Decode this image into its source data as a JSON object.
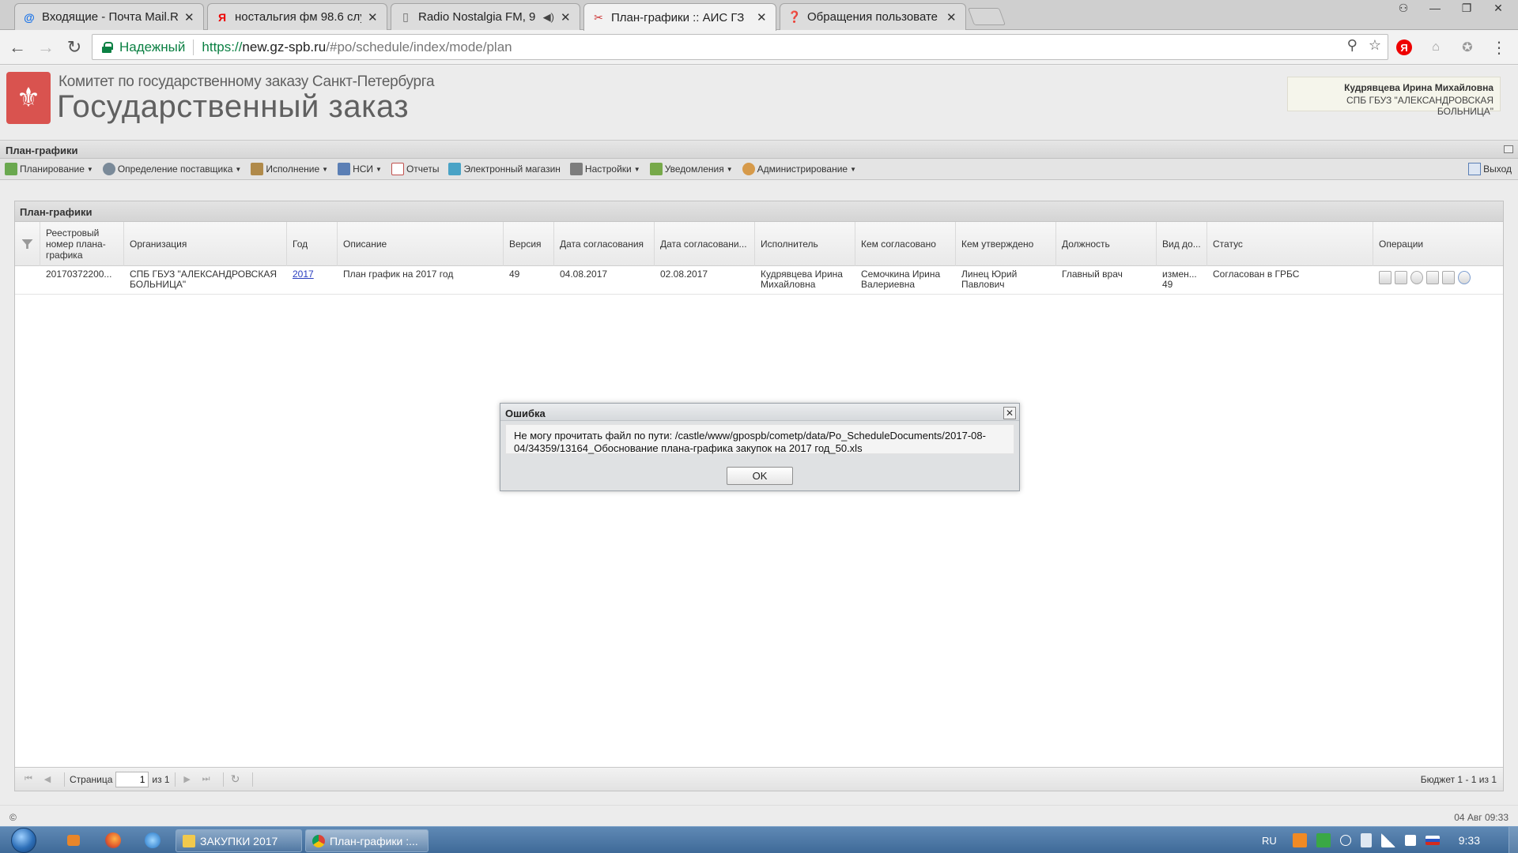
{
  "browser": {
    "tabs": [
      {
        "title": "Входящие - Почта Mail.R",
        "icon": "mail-icon",
        "active": false
      },
      {
        "title": "ностальгия фм 98.6 слу",
        "icon": "yandex-icon",
        "active": false
      },
      {
        "title": "Radio Nostalgia FM, 9",
        "icon": "page-icon",
        "active": false,
        "audio": true
      },
      {
        "title": "План-графики :: АИС ГЗ",
        "icon": "tools-icon",
        "active": true
      },
      {
        "title": "Обращения пользовате",
        "icon": "help-icon",
        "active": false
      }
    ],
    "secure_label": "Надежный",
    "url_scheme": "https://",
    "url_host": "new.gz-spb.ru",
    "url_path": "/#po/schedule/index/mode/plan"
  },
  "header": {
    "org_sub": "Комитет по государственному заказу Санкт-Петербурга",
    "org_main": "Государственный заказ",
    "user_name": "Кудрявцева Ирина Михайловна",
    "user_org": "СПБ ГБУЗ \"АЛЕКСАНДРОВСКАЯ БОЛЬНИЦА\""
  },
  "module_title": "План-графики",
  "menu": [
    {
      "label": "Планирование",
      "caret": true,
      "color": "#6aa84f"
    },
    {
      "label": "Определение поставщика",
      "caret": true,
      "color": "#7a8a99"
    },
    {
      "label": "Исполнение",
      "caret": true,
      "color": "#b08a4a"
    },
    {
      "label": "НСИ",
      "caret": true,
      "color": "#5b7fb5"
    },
    {
      "label": "Отчеты",
      "caret": false,
      "color": "#c0504d"
    },
    {
      "label": "Электронный магазин",
      "caret": false,
      "color": "#4aa3c6"
    },
    {
      "label": "Настройки",
      "caret": true,
      "color": "#7d7d7d"
    },
    {
      "label": "Уведомления",
      "caret": true,
      "color": "#77a94a"
    },
    {
      "label": "Администрирование",
      "caret": true,
      "color": "#d69a4a"
    }
  ],
  "logout_label": "Выход",
  "panel_title": "План-графики",
  "grid": {
    "columns": [
      "Реестровый номер плана-графика",
      "Организация",
      "Год",
      "Описание",
      "Версия",
      "Дата согласования",
      "Дата согласовани...",
      "Исполнитель",
      "Кем согласовано",
      "Кем утверждено",
      "Должность",
      "Вид до...",
      "Статус",
      "Операции"
    ],
    "rows": [
      {
        "reg_number": "20170372200...",
        "org": "СПБ ГБУЗ \"АЛЕКСАНДРОВСКАЯ БОЛЬНИЦА\"",
        "year": "2017",
        "description": "План график на 2017 год",
        "version": "49",
        "approve_date": "04.08.2017",
        "approve_date2": "02.08.2017",
        "executor": "Кудрявцева Ирина Михайловна",
        "agreed_by": "Семочкина Ирина Валериевна",
        "approved_by": "Линец Юрий Павлович",
        "position": "Главный врач",
        "doc_type": "измен... 49",
        "status": "Согласован в ГРБС"
      }
    ]
  },
  "pager": {
    "page_label": "Страница",
    "page_value": "1",
    "of_label": "из 1",
    "info": "Бюджет 1 - 1 из 1"
  },
  "footer": {
    "copyright": "©",
    "datetime": "04 Авг 09:33"
  },
  "dialog": {
    "title": "Ошибка",
    "message": "Не могу прочитать файл по пути: /castle/www/gpospb/cometp/data/Po_ScheduleDocuments/2017-08-04/34359/13164_Обоснование плана-графика закупок на 2017 год_50.xls",
    "ok_label": "OK"
  },
  "taskbar": {
    "tasks": [
      {
        "label": "ЗАКУПКИ 2017",
        "icon": "folder-icon"
      },
      {
        "label": "План-графики :...",
        "icon": "chrome-icon"
      }
    ],
    "lang": "RU",
    "clock": "9:33"
  }
}
